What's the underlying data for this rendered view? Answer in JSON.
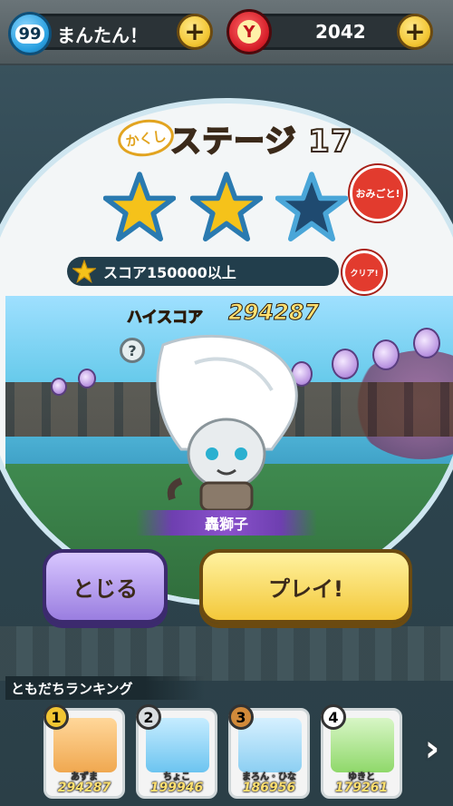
{
  "topbar": {
    "energy_count": "99",
    "energy_status": "まんたん！",
    "plus_label": "+",
    "coin_symbol": "Y",
    "coin_count": "2042"
  },
  "stage": {
    "tag": "かくし",
    "title": "ステージ 17",
    "stars_earned": 2,
    "stars_total": 3,
    "badge_top": "おみごと!",
    "badge_clear": "クリア!",
    "condition": "スコア150000以上",
    "hiscore_label": "ハイスコア",
    "hiscore_value": "294287",
    "help_label": "?",
    "character_name": "轟獅子"
  },
  "buttons": {
    "close": "とじる",
    "play": "プレイ!"
  },
  "ranking": {
    "title": "ともだちランキング",
    "next": "›",
    "entries": [
      {
        "rank": "1",
        "name": "あずま",
        "score": "294287",
        "medal_color": "#f2c532",
        "card_color": "#ffc27a"
      },
      {
        "rank": "2",
        "name": "ちょこ",
        "score": "199946",
        "medal_color": "#d8dde0",
        "card_color": "#9fd8ff"
      },
      {
        "rank": "3",
        "name": "まろん・ひな",
        "score": "186956",
        "medal_color": "#d28a3a",
        "card_color": "#a6d8ff"
      },
      {
        "rank": "4",
        "name": "ゆきと",
        "score": "179261",
        "medal_color": "#ffffff",
        "card_color": "#b2e8a0"
      }
    ]
  },
  "colors": {
    "star_gold": "#f5c21a",
    "star_empty": "#1f4a70",
    "play_button": "#f3c83a",
    "close_button": "#9a7ee0"
  }
}
